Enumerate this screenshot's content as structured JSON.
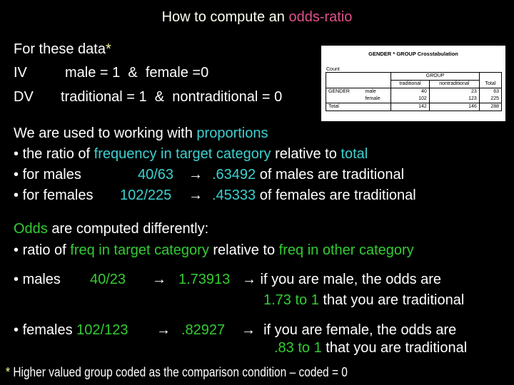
{
  "title": {
    "prefix": "How to compute an ",
    "highlight": "odds-ratio"
  },
  "data_block": {
    "heading": "For these data",
    "asterisk": "*",
    "iv_label": "IV",
    "iv_text": "male = 1  &  female =0",
    "dv_label": "DV",
    "dv_text": "traditional = 1  &  nontraditional = 0"
  },
  "crosstab": {
    "caption": "GENDER * GROUP Crosstabulation",
    "count_label": "Count",
    "group_header": "GROUP",
    "columns": [
      "traditional",
      "nontraditional",
      "Total"
    ],
    "row_var": "GENDER",
    "rows": [
      {
        "group": "GENDER",
        "label": "male",
        "values": [
          "40",
          "23",
          "63"
        ]
      },
      {
        "group": "",
        "label": "female",
        "values": [
          "102",
          "123",
          "225"
        ]
      },
      {
        "group": "Total",
        "label": "",
        "values": [
          "142",
          "146",
          "288"
        ]
      }
    ]
  },
  "proportions": {
    "intro": "We are used to working with ",
    "intro_hl": "proportions",
    "line1": {
      "bullet": "•",
      "a": " the ratio of ",
      "b": "frequency in target category",
      "c": " relative to ",
      "d": "total"
    },
    "line2": {
      "bullet": "•",
      "a": " for males",
      "b": "40/63",
      "arrow": "→",
      "c": ".63492",
      "d": " of males are traditional"
    },
    "line3": {
      "bullet": "•",
      "a": " for females",
      "b": "102/225",
      "arrow": "→",
      "c": ".45333",
      "d": " of females are traditional"
    }
  },
  "odds": {
    "intro_hl": "Odds",
    "intro": " are computed differently:",
    "line1": {
      "bullet": "•",
      "a": " ratio of ",
      "b": "freq in target category",
      "c": " relative to ",
      "d": "freq in other category"
    },
    "males": {
      "bullet": "•",
      "label": " males",
      "ratio": "40/23",
      "arrow1": "→",
      "value": "1.73913",
      "arrow2": "→",
      "text": " if you are male, the odds are",
      "odds_hl": "1.73 to 1",
      "tail": " that you are traditional"
    },
    "females": {
      "bullet": "•",
      "label": " females ",
      "ratio": "102/123",
      "arrow1": "→",
      "value": ".82927",
      "arrow2": "→",
      "text": "  if you are female, the odds are",
      "odds_hl": ".83 to 1",
      "tail": " that you are traditional"
    }
  },
  "footnote": {
    "asterisk": "*",
    "text": " Higher valued group coded as the comparison condition – coded = 0"
  },
  "colors": {
    "background": "#000000",
    "text": "#ffffff",
    "title_highlight": "#e0508a",
    "proportion_highlight": "#3fd0d0",
    "odds_highlight": "#33cc33",
    "asterisk": "#ffff99"
  }
}
